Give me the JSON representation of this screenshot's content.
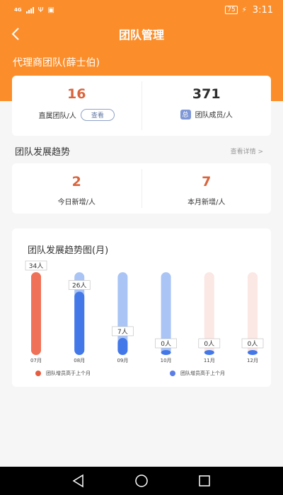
{
  "status_bar": {
    "network": "4G",
    "battery": "75",
    "time": "3:11"
  },
  "nav": {
    "title": "团队管理"
  },
  "team": {
    "name": "代理商团队(薛士伯)"
  },
  "summary": {
    "direct_value": "16",
    "direct_label": "直属团队/人",
    "view_label": "查看",
    "members_value": "371",
    "members_badge": "总",
    "members_label": "团队成员/人"
  },
  "trend": {
    "title": "团队发展趋势",
    "details_label": "查看详情 >",
    "today_value": "2",
    "today_label": "今日新增/人",
    "month_value": "7",
    "month_label": "本月新增/人"
  },
  "chart_data": {
    "type": "bar",
    "title": "团队发展趋势图(月)",
    "categories": [
      "07月",
      "08月",
      "09月",
      "10月",
      "11月",
      "12月"
    ],
    "values": [
      34,
      26,
      7,
      0,
      0,
      0
    ],
    "value_labels": [
      "34人",
      "26人",
      "7人",
      "0人",
      "0人",
      "0人"
    ],
    "ylim": [
      0,
      34
    ],
    "legend": [
      {
        "label": "团队增员高于上个月",
        "color": "#e65c3f"
      },
      {
        "label": "团队增员高于上个月",
        "color": "#5b7ee6"
      }
    ],
    "colors": {
      "high_fill": "#ef7258",
      "high_track": "#ef7258",
      "blue_fill": "#4378e9",
      "blue_track": "#a9c4f5",
      "pale_track": "#fbe7e3"
    }
  }
}
